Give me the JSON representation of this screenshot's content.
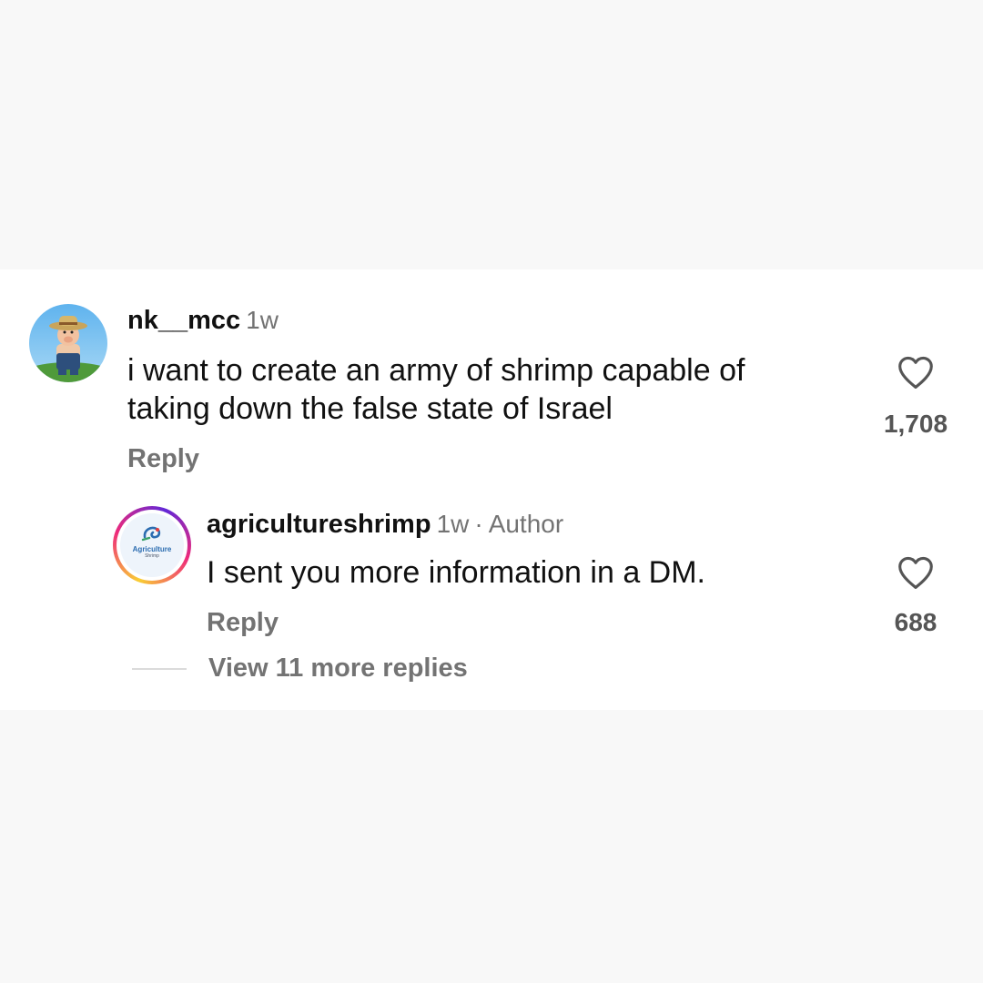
{
  "comments": [
    {
      "username": "nk__mcc",
      "time": "1w",
      "text_lines": [
        "i want to create an army of shrimp capable of",
        "taking down the false state of Israel"
      ],
      "reply_label": "Reply",
      "likes": "1,708",
      "avatar_icon": "farmer-avatar-icon"
    }
  ],
  "reply": {
    "username": "agricultureshrimp",
    "time": "1w",
    "separator": "·",
    "author_badge": "Author",
    "text": "I sent you more information in a DM.",
    "reply_label": "Reply",
    "likes": "688",
    "avatar_logo_text": "Agriculture",
    "avatar_logo_subtext": "Shrimp"
  },
  "view_more_label": "View 11 more replies",
  "colors": {
    "page_bg": "#f8f8f8",
    "card_bg": "#ffffff",
    "secondary_text": "#737373",
    "story_ring_start": "#f9ce34",
    "story_ring_mid": "#ee2a7b",
    "story_ring_end": "#6228d7"
  }
}
